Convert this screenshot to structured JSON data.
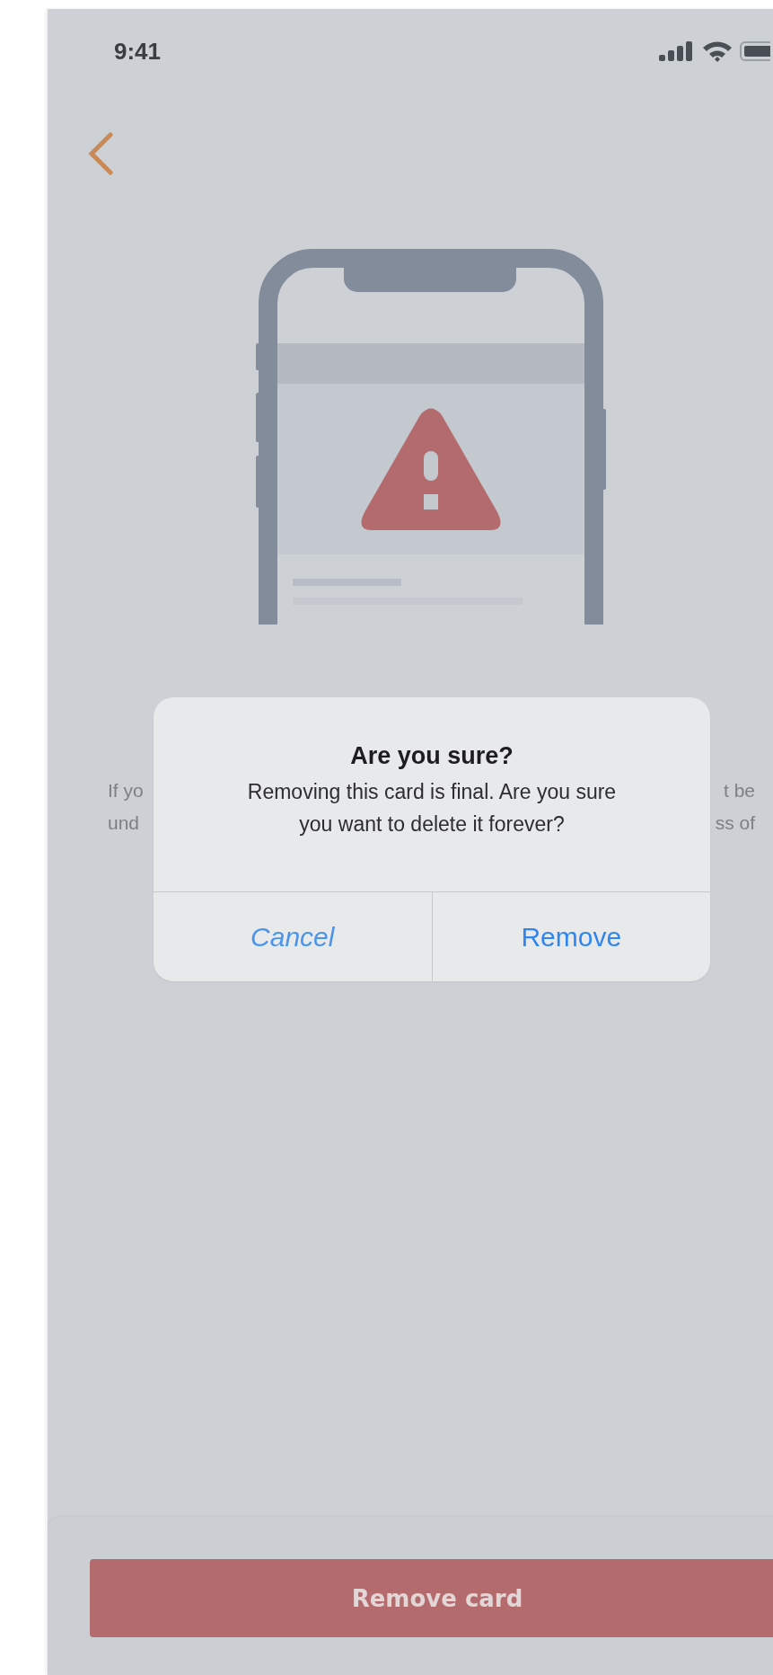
{
  "status_bar": {
    "time": "9:41"
  },
  "background_text": {
    "line_1_start": "If yo",
    "line_1_end": "t be",
    "line_2_start": "und",
    "line_2_end": "ss of"
  },
  "dialog": {
    "title": "Are you sure?",
    "message": "Removing this card is final. Are you sure you want to delete it forever?",
    "actions": [
      {
        "label": "Cancel",
        "kind": "cancel"
      },
      {
        "label": "Remove",
        "kind": "default"
      }
    ]
  },
  "primary_button": {
    "label": "Remove card"
  }
}
